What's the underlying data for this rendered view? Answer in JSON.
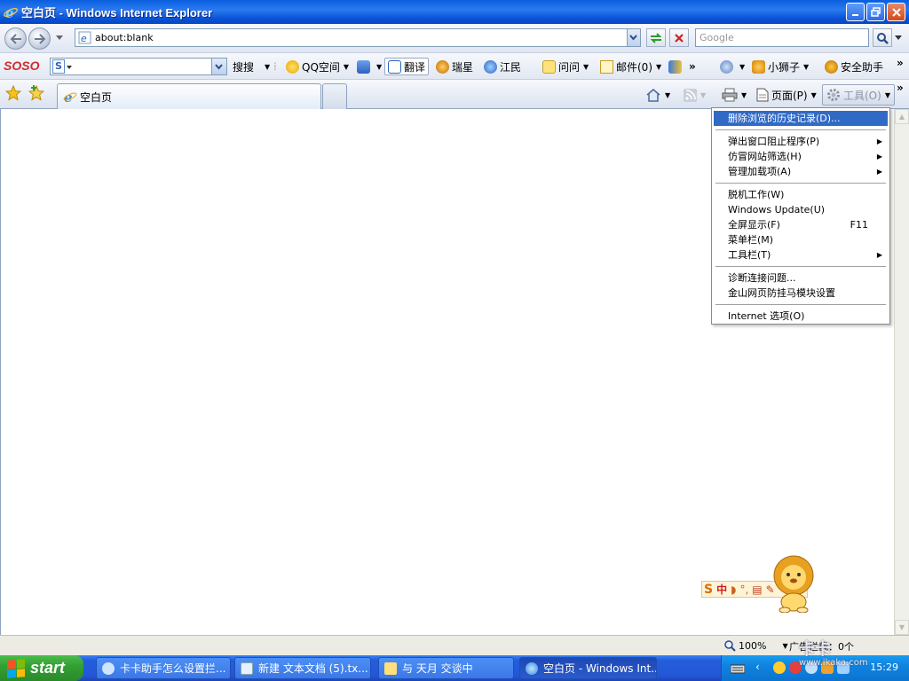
{
  "window": {
    "title": "空白页 - Windows Internet Explorer"
  },
  "address_bar": {
    "url": "about:blank",
    "search_placeholder": "Google"
  },
  "links_toolbar": {
    "soso_brand": "SOSO",
    "soso_search_letter": "S",
    "search_label": "搜搜",
    "qq_space": "QQ空间",
    "translate": "翻译",
    "rising": "瑞星",
    "jiangmin": "江民",
    "ask": "问问",
    "mail": "邮件(0)",
    "more_chevron": "»",
    "lion": "小狮子",
    "security_assistant": "安全助手"
  },
  "tabs": {
    "items": [
      {
        "label": "空白页"
      }
    ]
  },
  "command_bar": {
    "page": "页面(P)",
    "tools": "工具(O)",
    "more_chevron": "»"
  },
  "tools_menu": {
    "groups": [
      [
        {
          "label": "删除浏览的历史记录(D)...",
          "highlighted": true
        }
      ],
      [
        {
          "label": "弹出窗口阻止程序(P)",
          "submenu": true
        },
        {
          "label": "仿冒网站筛选(H)",
          "submenu": true
        },
        {
          "label": "管理加载项(A)",
          "submenu": true
        }
      ],
      [
        {
          "label": "脱机工作(W)"
        },
        {
          "label": "Windows Update(U)"
        },
        {
          "label": "全屏显示(F)",
          "shortcut": "F11"
        },
        {
          "label": "菜单栏(M)"
        },
        {
          "label": "工具栏(T)",
          "submenu": true
        }
      ],
      [
        {
          "label": "诊断连接问题..."
        },
        {
          "label": "金山网页防挂马模块设置"
        }
      ],
      [
        {
          "label": "Internet 选项(O)"
        }
      ]
    ]
  },
  "ime_toolbar": {
    "mode": "中"
  },
  "status_bar": {
    "zoom": "100%",
    "ad_block": "广告拦截：0个"
  },
  "taskbar": {
    "start_label": "start",
    "tasks": [
      {
        "label": "卡卡助手怎么设置拦..."
      },
      {
        "label": "新建 文本文档 (5).tx..."
      },
      {
        "label": "与 天月 交谈中"
      },
      {
        "label": "空白页 - Windows Int...",
        "active": true
      }
    ],
    "clock": "15:29"
  },
  "watermark": {
    "brand": "卡卡",
    "site": "www.ikaka.com"
  },
  "colors": {
    "menu_highlight": "#316ac5",
    "titlebar": "#0a5fde",
    "taskbar": "#245edb",
    "start_green": "#33a033"
  }
}
